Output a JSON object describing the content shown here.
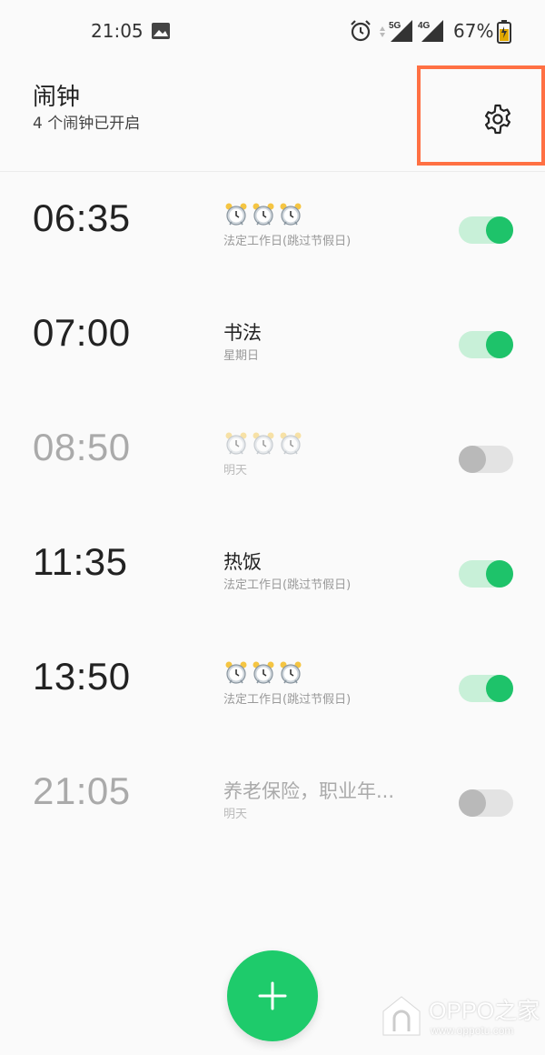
{
  "status_bar": {
    "time": "21:05",
    "battery_percent": "67%",
    "network_5g": "5G",
    "network_4g": "4G",
    "icons": [
      "gallery-icon",
      "alarm-icon",
      "signal-5g-icon",
      "signal-4g-icon",
      "battery-charging-icon"
    ]
  },
  "header": {
    "title": "闹钟",
    "subtitle": "4 个闹钟已开启",
    "settings_icon": "gear-icon",
    "highlight_color": "#ff7043"
  },
  "alarms": [
    {
      "time": "06:35",
      "label": "",
      "label_icons": "⏰⏰⏰",
      "repeat": "法定工作日(跳过节假日)",
      "enabled": true
    },
    {
      "time": "07:00",
      "label": "书法",
      "label_icons": "",
      "repeat": "星期日",
      "enabled": true
    },
    {
      "time": "08:50",
      "label": "",
      "label_icons": "⏰⏰⏰",
      "repeat": "明天",
      "enabled": false
    },
    {
      "time": "11:35",
      "label": "热饭",
      "label_icons": "",
      "repeat": "法定工作日(跳过节假日)",
      "enabled": true
    },
    {
      "time": "13:50",
      "label": "",
      "label_icons": "⏰⏰⏰",
      "repeat": "法定工作日(跳过节假日)",
      "enabled": true
    },
    {
      "time": "21:05",
      "label": "养老保险，职业年...",
      "label_icons": "",
      "repeat": "明天",
      "enabled": false
    }
  ],
  "fab": {
    "icon": "plus-icon",
    "color": "#1ecb6b"
  },
  "watermark": {
    "text": "OPPO之家",
    "url": "www.oppotu.com"
  },
  "colors": {
    "toggle_on": "#1ec36a",
    "toggle_on_track": "#c8f0d8",
    "toggle_off": "#b9b9b9",
    "toggle_off_track": "#e3e3e3"
  }
}
